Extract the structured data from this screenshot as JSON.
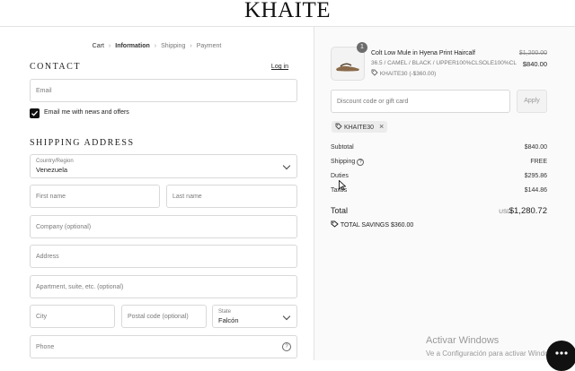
{
  "brand": {
    "logo": "KHAITE"
  },
  "breadcrumb": {
    "cart": "Cart",
    "information": "Information",
    "shipping": "Shipping",
    "payment": "Payment"
  },
  "contact": {
    "title": "Contact",
    "login_link": "Log in",
    "email_placeholder": "Email",
    "newsletter_label": "Email me with news and offers",
    "newsletter_checked": true
  },
  "shipping": {
    "title": "Shipping address",
    "country_label": "Country/Region",
    "country_value": "Venezuela",
    "first_name_placeholder": "First name",
    "last_name_placeholder": "Last name",
    "company_placeholder": "Company (optional)",
    "address_placeholder": "Address",
    "apartment_placeholder": "Apartment, suite, etc. (optional)",
    "city_placeholder": "City",
    "postal_placeholder": "Postal code (optional)",
    "state_label": "State",
    "state_value": "Falcón",
    "phone_placeholder": "Phone"
  },
  "order": {
    "quantity_badge": "1",
    "product_name": "Colt Low Mule in Hyena Print Haircalf",
    "variant": "36.5 / CAMEL / BLACK / UPPER100%CLSOLE100%CL",
    "line_discount": "KHAITE30 (-$360.00)",
    "price_original": "$1,200.00",
    "price_final": "$840.00",
    "discount_placeholder": "Discount code or gift card",
    "apply_label": "Apply",
    "applied_code": "KHAITE30"
  },
  "summary": {
    "subtotal_label": "Subtotal",
    "subtotal_value": "$840.00",
    "shipping_label": "Shipping",
    "shipping_value": "FREE",
    "duties_label": "Duties",
    "duties_value": "$295.86",
    "taxes_label": "Taxes",
    "taxes_value": "$144.86",
    "total_label": "Total",
    "total_currency": "USD",
    "total_value": "$1,280.72",
    "savings_label": "TOTAL SAVINGS",
    "savings_value": "$360.00"
  },
  "os_overlay": {
    "activate_title": "Activar Windows",
    "activate_sub": "Ve a Configuración para activar Windows."
  }
}
